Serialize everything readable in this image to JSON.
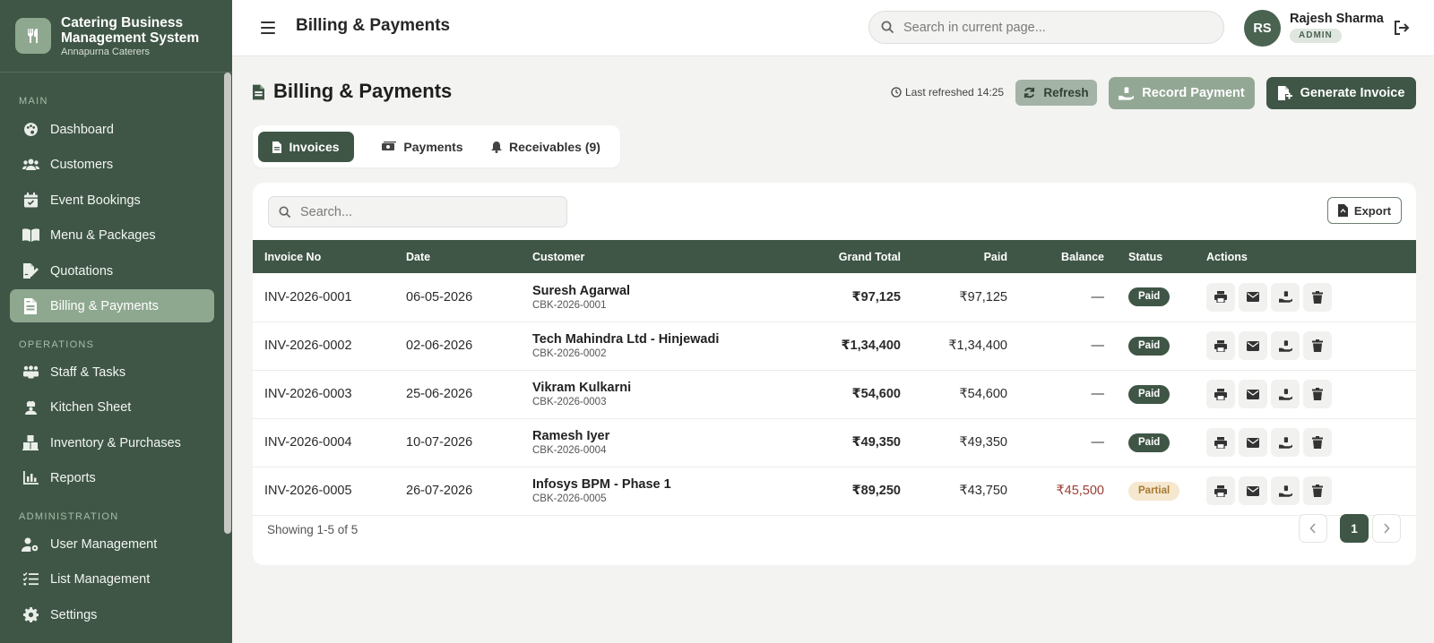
{
  "app": {
    "title": "Catering Business Management System",
    "subtitle": "Annapurna Caterers"
  },
  "sidebar": {
    "sections": [
      {
        "label": "MAIN"
      },
      {
        "label": "OPERATIONS"
      },
      {
        "label": "ADMINISTRATION"
      }
    ],
    "items": [
      {
        "label": "Dashboard",
        "icon": "palette-icon"
      },
      {
        "label": "Customers",
        "icon": "users-icon"
      },
      {
        "label": "Event Bookings",
        "icon": "calendar-check-icon"
      },
      {
        "label": "Menu & Packages",
        "icon": "book-open-icon"
      },
      {
        "label": "Quotations",
        "icon": "file-signature-icon"
      },
      {
        "label": "Billing & Payments",
        "icon": "file-invoice-icon",
        "active": true
      },
      {
        "label": "Staff & Tasks",
        "icon": "people-group-icon"
      },
      {
        "label": "Kitchen Sheet",
        "icon": "chef-icon"
      },
      {
        "label": "Inventory & Purchases",
        "icon": "boxes-icon"
      },
      {
        "label": "Reports",
        "icon": "bar-chart-icon"
      },
      {
        "label": "User Management",
        "icon": "user-gear-icon"
      },
      {
        "label": "List Management",
        "icon": "list-check-icon"
      },
      {
        "label": "Settings",
        "icon": "gear-icon"
      }
    ]
  },
  "topbar": {
    "title": "Billing & Payments",
    "search_placeholder": "Search in current page...",
    "user": {
      "initials": "RS",
      "name": "Rajesh Sharma",
      "role": "ADMIN"
    }
  },
  "page": {
    "title": "Billing & Payments",
    "last_refreshed": "Last refreshed 14:25",
    "buttons": {
      "refresh": "Refresh",
      "record_payment": "Record Payment",
      "generate_invoice": "Generate Invoice"
    },
    "tabs": [
      {
        "label": "Invoices",
        "active": true
      },
      {
        "label": "Payments"
      },
      {
        "label": "Receivables (9)"
      }
    ]
  },
  "table": {
    "search_placeholder": "Search...",
    "export_label": "Export",
    "columns": [
      "Invoice No",
      "Date",
      "Customer",
      "Grand Total",
      "Paid",
      "Balance",
      "Status",
      "Actions"
    ],
    "rows": [
      {
        "invoice": "INV-2026-0001",
        "date": "06-05-2026",
        "customer": "Suresh Agarwal",
        "code": "CBK-2026-0001",
        "grand_total": "₹97,125",
        "paid": "₹97,125",
        "balance": "—",
        "status": "Paid"
      },
      {
        "invoice": "INV-2026-0002",
        "date": "02-06-2026",
        "customer": "Tech Mahindra Ltd - Hinjewadi",
        "code": "CBK-2026-0002",
        "grand_total": "₹1,34,400",
        "paid": "₹1,34,400",
        "balance": "—",
        "status": "Paid"
      },
      {
        "invoice": "INV-2026-0003",
        "date": "25-06-2026",
        "customer": "Vikram Kulkarni",
        "code": "CBK-2026-0003",
        "grand_total": "₹54,600",
        "paid": "₹54,600",
        "balance": "—",
        "status": "Paid"
      },
      {
        "invoice": "INV-2026-0004",
        "date": "10-07-2026",
        "customer": "Ramesh Iyer",
        "code": "CBK-2026-0004",
        "grand_total": "₹49,350",
        "paid": "₹49,350",
        "balance": "—",
        "status": "Paid"
      },
      {
        "invoice": "INV-2026-0005",
        "date": "26-07-2026",
        "customer": "Infosys BPM - Phase 1",
        "code": "CBK-2026-0005",
        "grand_total": "₹89,250",
        "paid": "₹43,750",
        "balance": "₹45,500",
        "status": "Partial"
      }
    ],
    "footer": {
      "showing": "Showing 1-5 of 5",
      "current_page": "1"
    }
  },
  "colors": {
    "sidebar": "#3f5646",
    "accent": "#8ea88f",
    "status_paid": "#3f5646",
    "status_partial_bg": "#f6e7cf",
    "balance_due": "#9b3d34"
  }
}
